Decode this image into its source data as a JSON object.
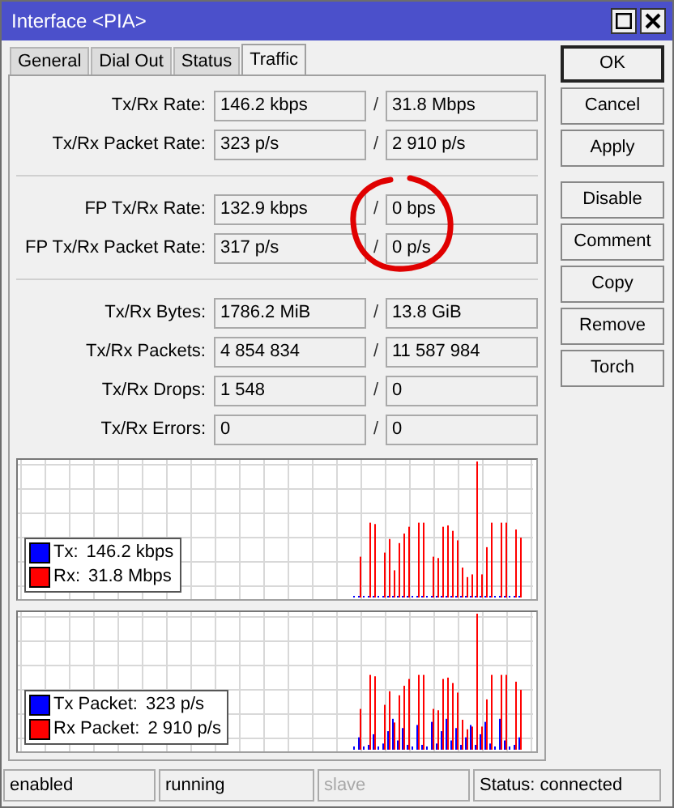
{
  "window": {
    "title": "Interface <PIA>"
  },
  "tabs": [
    {
      "label": "General",
      "selected": false
    },
    {
      "label": "Dial Out",
      "selected": false
    },
    {
      "label": "Status",
      "selected": false
    },
    {
      "label": "Traffic",
      "selected": true
    }
  ],
  "groups": [
    {
      "rows": [
        {
          "label": "Tx/Rx Rate:",
          "tx": "146.2 kbps",
          "rx": "31.8 Mbps"
        },
        {
          "label": "Tx/Rx Packet Rate:",
          "tx": "323 p/s",
          "rx": "2 910 p/s"
        }
      ]
    },
    {
      "rows": [
        {
          "label": "FP Tx/Rx Rate:",
          "tx": "132.9 kbps",
          "rx": "0 bps"
        },
        {
          "label": "FP Tx/Rx Packet Rate:",
          "tx": "317 p/s",
          "rx": "0 p/s"
        }
      ],
      "annotated": true
    },
    {
      "rows": [
        {
          "label": "Tx/Rx Bytes:",
          "tx": "1786.2 MiB",
          "rx": "13.8 GiB"
        },
        {
          "label": "Tx/Rx Packets:",
          "tx": "4 854 834",
          "rx": "11 587 984"
        },
        {
          "label": "Tx/Rx Drops:",
          "tx": "1 548",
          "rx": "0"
        },
        {
          "label": "Tx/Rx Errors:",
          "tx": "0",
          "rx": "0"
        }
      ]
    }
  ],
  "separator": "/",
  "graphs": [
    {
      "kind": "rate",
      "legend": [
        {
          "name": "Tx:",
          "value": "146.2 kbps",
          "color": "#0000ff"
        },
        {
          "name": "Rx:",
          "value": "31.8 Mbps",
          "color": "#ff0000"
        }
      ]
    },
    {
      "kind": "packet",
      "legend": [
        {
          "name": "Tx Packet:",
          "value": "323 p/s",
          "color": "#0000ff"
        },
        {
          "name": "Rx Packet:",
          "value": "2 910 p/s",
          "color": "#ff0000"
        }
      ]
    }
  ],
  "button_groups": [
    [
      "OK",
      "Cancel",
      "Apply"
    ],
    [
      "Disable",
      "Comment",
      "Copy",
      "Remove",
      "Torch"
    ]
  ],
  "status_bar": [
    {
      "text": "enabled",
      "disabled": false
    },
    {
      "text": "running",
      "disabled": false
    },
    {
      "text": "slave",
      "disabled": true
    },
    {
      "text": "Status: connected",
      "disabled": false
    }
  ]
}
